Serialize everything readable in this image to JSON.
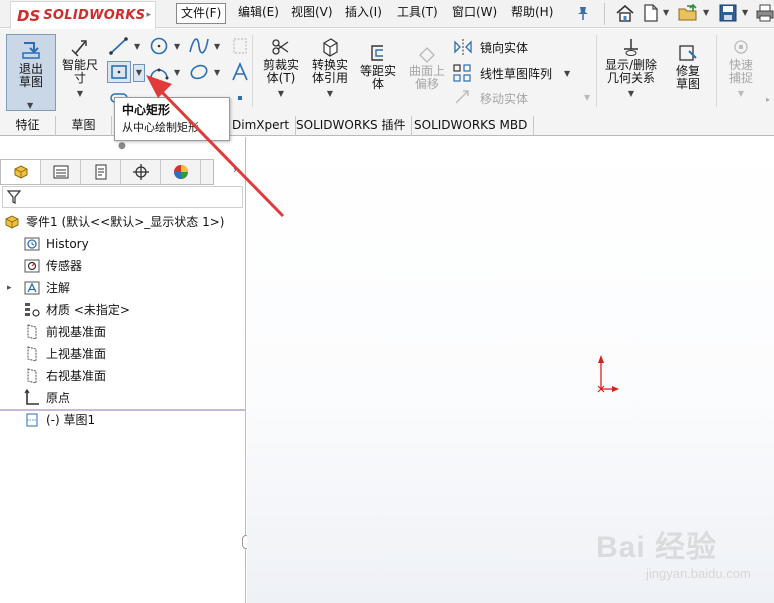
{
  "app": {
    "logo_ds": "DS",
    "logo_name": "SOLIDWORKS"
  },
  "menu": {
    "file": "文件(F)",
    "edit": "编辑(E)",
    "view": "视图(V)",
    "insert": "插入(I)",
    "tools": "工具(T)",
    "window": "窗口(W)",
    "help": "帮助(H)"
  },
  "ribbon": {
    "exit_sketch": "退出草图",
    "smart_dim": "智能尺寸",
    "trim": "剪裁实体(T)",
    "convert": "转换实体引用",
    "offset": "等距实体",
    "surface_offset": "曲面上偏移",
    "mirror": "镜向实体",
    "linear_pattern": "线性草图阵列",
    "move": "移动实体",
    "show_relations": "显示/删除几何关系",
    "repair": "修复草图",
    "quick_snap": "快速捕捉"
  },
  "tooltip": {
    "title": "中心矩形",
    "desc": "从中心绘制矩形"
  },
  "tabs": [
    "特征",
    "草图",
    "DimXpert",
    "SOLIDWORKS 插件",
    "SOLIDWORKS MBD"
  ],
  "tree": {
    "root": "零件1  (默认<<默认>_显示状态 1>)",
    "items": [
      "History",
      "传感器",
      "注解",
      "材质 <未指定>",
      "前视基准面",
      "上视基准面",
      "右视基准面",
      "原点",
      "(-) 草图1"
    ]
  },
  "watermark": {
    "main": "Bai 经验",
    "sub": "jingyan.baidu.com"
  },
  "colors": {
    "accent_red": "#d22b2b",
    "arrow_red": "#e03a3a",
    "selection_blue": "#c9d7e6"
  }
}
